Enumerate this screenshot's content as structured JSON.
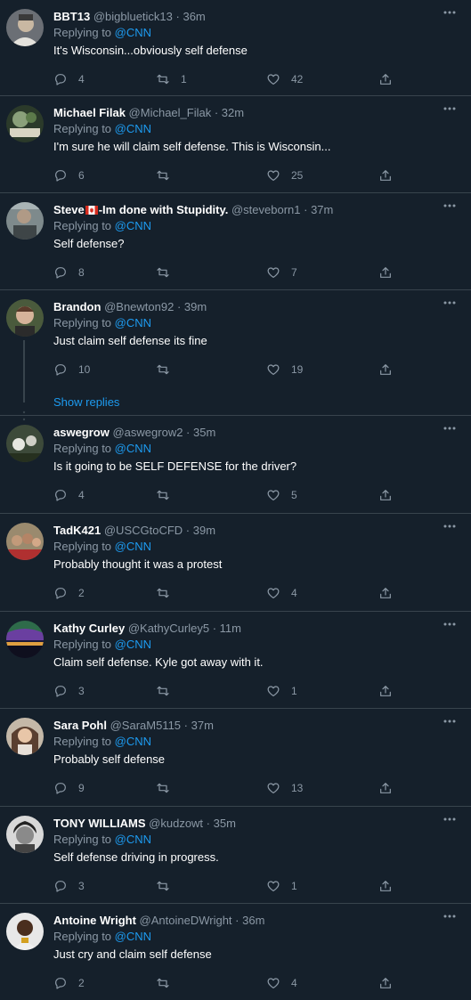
{
  "replying_label": "Replying to",
  "tweets": [
    {
      "name": "BBT13",
      "handle": "@bigbluetick13",
      "time": "36m",
      "mention": "@CNN",
      "text": "It's Wisconsin...obviously self defense",
      "replies": "4",
      "retweets": "1",
      "likes": "42"
    },
    {
      "name": "Michael Filak",
      "handle": "@Michael_Filak",
      "time": "32m",
      "mention": "@CNN",
      "text": "I'm sure he will claim self defense. This is Wisconsin...",
      "replies": "6",
      "retweets": "",
      "likes": "25"
    },
    {
      "name_before_flag": "Steve",
      "name_after_flag": "-Im done with Stupidity.",
      "handle": "@steveborn1",
      "time": "37m",
      "mention": "@CNN",
      "text": "Self defense?",
      "replies": "8",
      "retweets": "",
      "likes": "7"
    },
    {
      "name": "Brandon",
      "handle": "@Bnewton92",
      "time": "39m",
      "mention": "@CNN",
      "text": "Just claim self defense its fine",
      "replies": "10",
      "retweets": "",
      "likes": "19",
      "show_replies": "Show replies"
    },
    {
      "name": "aswegrow",
      "handle": "@aswegrow2",
      "time": "35m",
      "mention": "@CNN",
      "text": "Is it going to be SELF DEFENSE for the driver?",
      "replies": "4",
      "retweets": "",
      "likes": "5"
    },
    {
      "name": "TadK421",
      "handle": "@USCGtoCFD",
      "time": "39m",
      "mention": "@CNN",
      "text": "Probably thought it was a protest",
      "replies": "2",
      "retweets": "",
      "likes": "4"
    },
    {
      "name": "Kathy Curley",
      "handle": "@KathyCurley5",
      "time": "11m",
      "mention": "@CNN",
      "text": "Claim self defense.  Kyle got away with it.",
      "replies": "3",
      "retweets": "",
      "likes": "1"
    },
    {
      "name": "Sara Pohl",
      "handle": "@SaraM5115",
      "time": "37m",
      "mention": "@CNN",
      "text": "Probably self defense",
      "replies": "9",
      "retweets": "",
      "likes": "13"
    },
    {
      "name": "TONY WILLIAMS",
      "handle": "@kudzowt",
      "time": "35m",
      "mention": "@CNN",
      "text": "Self defense driving in progress.",
      "replies": "3",
      "retweets": "",
      "likes": "1"
    },
    {
      "name": "Antoine Wright",
      "handle": "@AntoineDWright",
      "time": "36m",
      "mention": "@CNN",
      "text": "Just cry and claim self defense",
      "replies": "2",
      "retweets": "",
      "likes": "4"
    }
  ],
  "colors": {
    "background": "#15202b",
    "divider": "#38444d",
    "secondary_text": "#8b98a5",
    "accent": "#1d9bf0"
  },
  "icons": [
    "reply-icon",
    "retweet-icon",
    "like-icon",
    "share-icon",
    "more-options-icon",
    "canada-flag-icon"
  ]
}
